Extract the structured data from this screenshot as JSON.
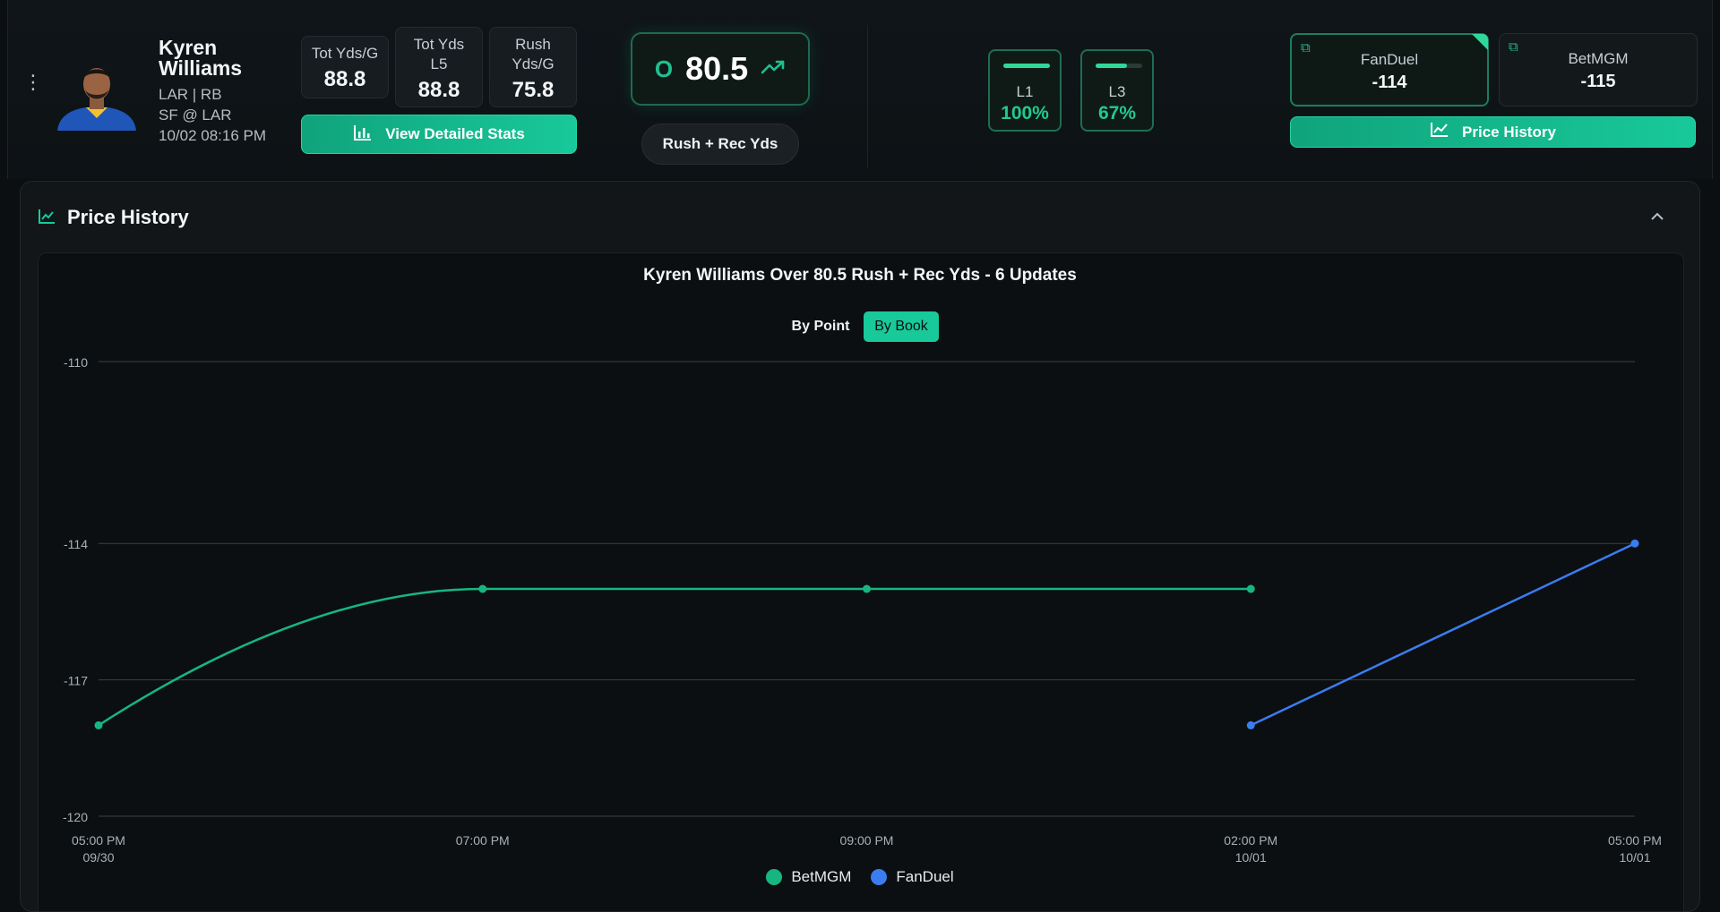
{
  "player": {
    "name": "Kyren Williams",
    "team_pos": "LAR | RB",
    "matchup": "SF @ LAR",
    "datetime": "10/02 08:16 PM"
  },
  "stats": [
    {
      "label": "Tot Yds/G",
      "value": "88.8"
    },
    {
      "label": "Tot Yds L5",
      "value": "88.8"
    },
    {
      "label": "Rush Yds/G",
      "value": "75.8"
    }
  ],
  "detailed_button": "View Detailed Stats",
  "line": {
    "side": "O",
    "value": "80.5",
    "market": "Rush + Rec Yds"
  },
  "hit_rates": [
    {
      "label": "L1",
      "pct": "100%",
      "fill": 1.0
    },
    {
      "label": "L3",
      "pct": "67%",
      "fill": 0.67
    }
  ],
  "books": [
    {
      "name": "FanDuel",
      "odds": "-114"
    },
    {
      "name": "BetMGM",
      "odds": "-115"
    }
  ],
  "price_history_button": "Price History",
  "panel": {
    "title": "Price History"
  },
  "chart_toggle": {
    "by_point": "By Point",
    "by_book": "By Book"
  },
  "colors": {
    "betmgm": "#17b67f",
    "fanduel": "#3b7cf0",
    "accent": "#18c99a"
  },
  "chart_data": {
    "type": "line",
    "title": "Kyren Williams Over 80.5 Rush + Rec Yds - 6 Updates",
    "x_ticks": [
      {
        "time": "05:00 PM",
        "date": "09/30"
      },
      {
        "time": "07:00 PM",
        "date": ""
      },
      {
        "time": "09:00 PM",
        "date": ""
      },
      {
        "time": "02:00 PM",
        "date": "10/01"
      },
      {
        "time": "05:00 PM",
        "date": "10/01"
      }
    ],
    "ylim": [
      -120,
      -110
    ],
    "y_ticks": [
      -110,
      -114,
      -117,
      -120
    ],
    "grid": true,
    "legend": "bottom",
    "series": [
      {
        "name": "BetMGM",
        "color": "#17b67f",
        "x": [
          "05:00 PM 09/30",
          "07:00 PM",
          "09:00 PM",
          "02:00 PM 10/01"
        ],
        "x_index": [
          0,
          1,
          2,
          3
        ],
        "y": [
          -118,
          -115,
          -115,
          -115
        ]
      },
      {
        "name": "FanDuel",
        "color": "#3b7cf0",
        "x": [
          "02:00 PM 10/01",
          "05:00 PM 10/01"
        ],
        "x_index": [
          3,
          4
        ],
        "y": [
          -118,
          -114
        ]
      }
    ]
  }
}
